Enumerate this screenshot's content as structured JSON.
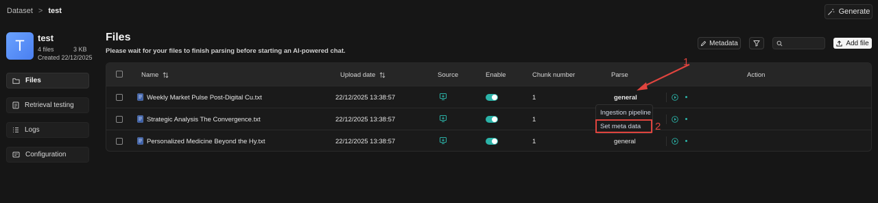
{
  "breadcrumb": {
    "root": "Dataset",
    "separator": ">",
    "current": "test"
  },
  "header": {
    "generate_label": "Generate"
  },
  "dataset": {
    "avatar_letter": "T",
    "name": "test",
    "files_count": "4 files",
    "size": "3 KB",
    "created": "Created 22/12/2025"
  },
  "sidebar": {
    "items": [
      {
        "label": "Files",
        "icon": "folder-icon",
        "active": true
      },
      {
        "label": "Retrieval testing",
        "icon": "document-search-icon",
        "active": false
      },
      {
        "label": "Logs",
        "icon": "list-icon",
        "active": false
      },
      {
        "label": "Configuration",
        "icon": "sliders-icon",
        "active": false
      }
    ]
  },
  "main": {
    "title": "Files",
    "subtitle": "Please wait for your files to finish parsing before starting an AI-powered chat.",
    "metadata_label": "Metadata",
    "search": {
      "value": "",
      "placeholder": ""
    },
    "add_file_label": "Add file"
  },
  "table": {
    "headers": {
      "name": "Name",
      "upload_date": "Upload date",
      "source": "Source",
      "enable": "Enable",
      "chunk_number": "Chunk number",
      "parse": "Parse",
      "action": "Action"
    },
    "rows": [
      {
        "name": "Weekly Market Pulse Post-Digital Cu.txt",
        "upload_date": "22/12/2025 13:38:57",
        "enabled": true,
        "chunk_number": "1",
        "parse": "general"
      },
      {
        "name": "Strategic Analysis The Convergence.txt",
        "upload_date": "22/12/2025 13:38:57",
        "enabled": true,
        "chunk_number": "1",
        "parse": ""
      },
      {
        "name": "Personalized Medicine Beyond the Hy.txt",
        "upload_date": "22/12/2025 13:38:57",
        "enabled": true,
        "chunk_number": "1",
        "parse": "general"
      }
    ]
  },
  "dropdown": {
    "items": [
      {
        "label": "Ingestion pipeline"
      },
      {
        "label": "Set meta data"
      }
    ]
  },
  "annotations": {
    "step1": "1",
    "step2": "2"
  },
  "colors": {
    "accent": "#2bb3a8",
    "annotation": "#e0443e",
    "avatar": "#5b8ff9"
  }
}
